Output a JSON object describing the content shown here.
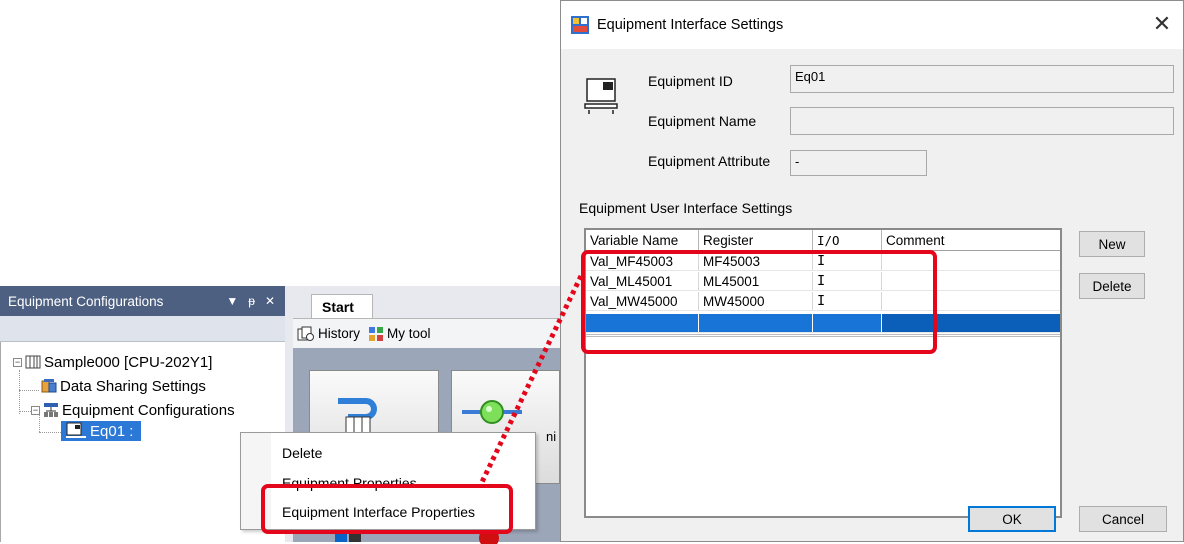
{
  "left": {
    "pane_title": "Equipment Configurations",
    "pane_controls": [
      "▼",
      "ꟷ",
      "✕"
    ],
    "tree": {
      "root": "Sample000 [CPU-202Y1]",
      "data_sharing": "Data Sharing Settings",
      "equipment_configs": "Equipment Configurations",
      "eq01": "Eq01 :"
    },
    "start_tab": "Start",
    "toolbar": {
      "history": "History",
      "my_tool": "My tool"
    },
    "ctx_menu": {
      "delete": "Delete",
      "properties": "Equipment Properties",
      "interface_properties": "Equipment Interface Properties"
    },
    "hidden_fragment": "ni"
  },
  "dialog": {
    "title": "Equipment Interface Settings",
    "fields": {
      "id_label": "Equipment ID",
      "id_value": "Eq01",
      "name_label": "Equipment Name",
      "name_value": "",
      "attr_label": "Equipment Attribute",
      "attr_value": "-"
    },
    "section": "Equipment User Interface Settings",
    "columns": [
      "Variable Name",
      "Register",
      "I/O",
      "Comment"
    ],
    "rows": [
      [
        "Val_MF45003",
        "MF45003",
        "I",
        ""
      ],
      [
        "Val_ML45001",
        "ML45001",
        "I",
        ""
      ],
      [
        "Val_MW45000",
        "MW45000",
        "I",
        ""
      ]
    ],
    "buttons": {
      "new": "New",
      "delete": "Delete",
      "ok": "OK",
      "cancel": "Cancel"
    }
  },
  "colors": {
    "highlight": "#e4061b",
    "selection": "#1874d6",
    "pane_header": "#4d6082"
  }
}
